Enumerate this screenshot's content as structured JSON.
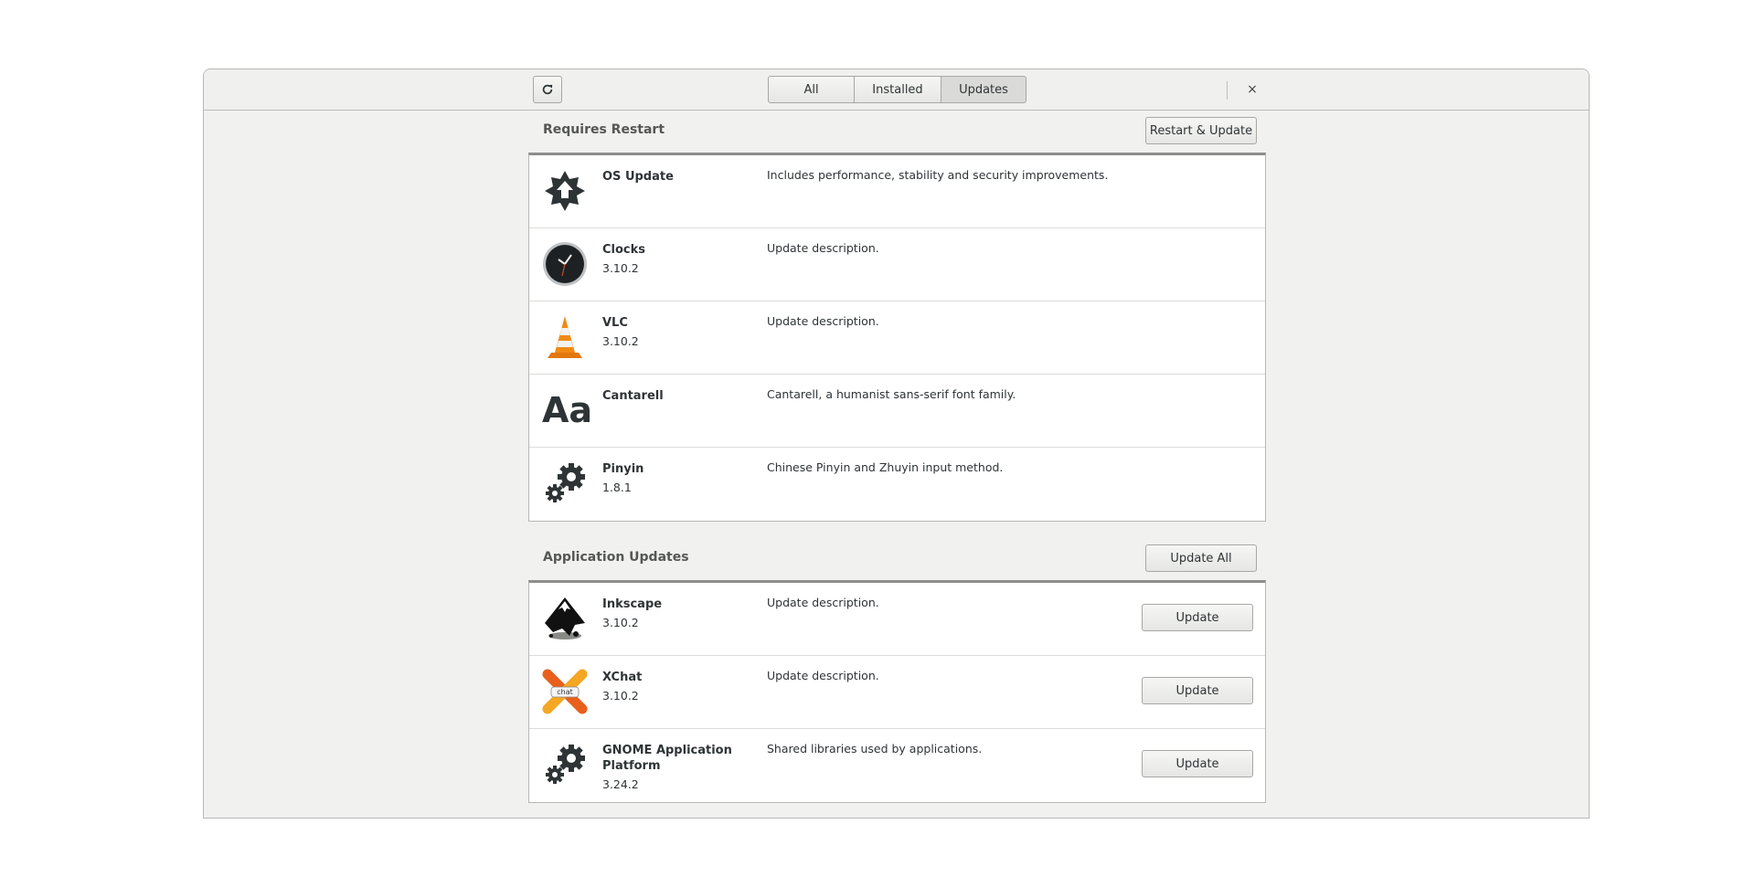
{
  "header": {
    "tabs": [
      {
        "label": "All"
      },
      {
        "label": "Installed"
      },
      {
        "label": "Updates",
        "active": true
      }
    ],
    "close_icon": "×"
  },
  "restart_section": {
    "title": "Requires Restart",
    "action_label": "Restart & Update",
    "items": [
      {
        "name": "OS Update",
        "version": "",
        "description": "Includes performance, stability and security improvements.",
        "icon": "os-update-icon"
      },
      {
        "name": "Clocks",
        "version": "3.10.2",
        "description": "Update description.",
        "icon": "clock-icon"
      },
      {
        "name": "VLC",
        "version": "3.10.2",
        "description": "Update description.",
        "icon": "vlc-cone-icon"
      },
      {
        "name": "Cantarell",
        "version": "",
        "description": "Cantarell, a humanist sans-serif font family.",
        "icon": "font-icon",
        "glyph": "Aa"
      },
      {
        "name": "Pinyin",
        "version": "1.8.1",
        "description": "Chinese Pinyin and Zhuyin input method.",
        "icon": "gears-icon"
      }
    ]
  },
  "app_section": {
    "title": "Application Updates",
    "action_label": "Update All",
    "update_label": "Update",
    "items": [
      {
        "name": "Inkscape",
        "version": "3.10.2",
        "description": "Update description.",
        "icon": "inkscape-icon"
      },
      {
        "name": "XChat",
        "version": "3.10.2",
        "description": "Update description.",
        "icon": "xchat-icon",
        "badge": "chat"
      },
      {
        "name": "GNOME Application Platform",
        "version": "3.24.2",
        "description": "Shared libraries used by applications.",
        "icon": "gears-icon"
      }
    ]
  }
}
